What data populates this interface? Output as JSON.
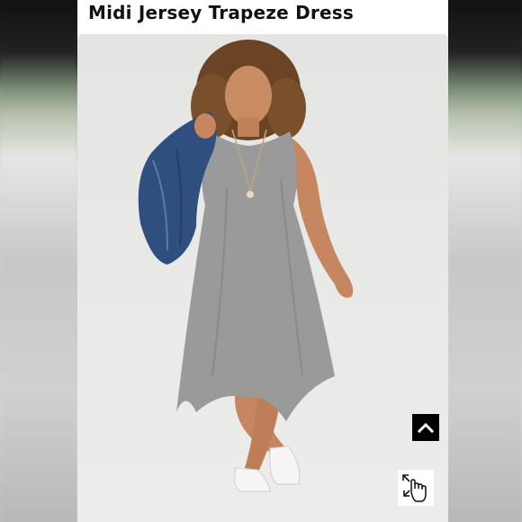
{
  "product": {
    "title": "Midi Jersey Trapeze Dress"
  },
  "photo": {
    "subject": "model-wearing-grey-trapeze-dress",
    "dress_color": "#9a9a9a",
    "jacket_color": "#2f4f7f",
    "background_color": "#e6e6e4"
  },
  "controls": {
    "scroll_top_icon": "chevron-up-icon",
    "zoom_icon": "hand-pointer-expand-icon"
  },
  "colors": {
    "card": "#ffffff",
    "title": "#111111",
    "scroll_button": "#000000"
  }
}
